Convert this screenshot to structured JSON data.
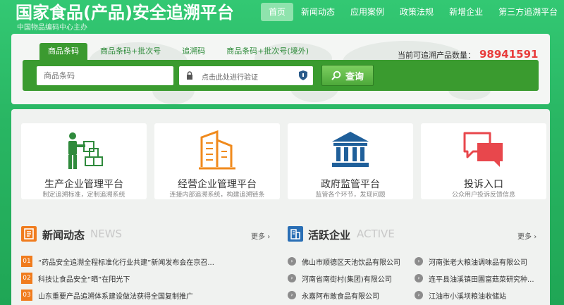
{
  "header": {
    "logo_title": "国家食品(产品)安全追溯平台",
    "logo_subtitle": "中国物品编码中心主办",
    "nav": [
      "首页",
      "新闻动态",
      "应用案例",
      "政策法规",
      "新增企业",
      "第三方追溯平台"
    ]
  },
  "search": {
    "tabs": [
      "商品条码",
      "商品条码+批次号",
      "追溯码",
      "商品条码+批次号(境外)"
    ],
    "count_label": "当前可追溯产品数量：",
    "count_value": "98941591",
    "barcode_placeholder": "商品条码",
    "verify_placeholder": "点击此处进行验证",
    "button_label": "查询"
  },
  "platforms": [
    {
      "title": "生产企业管理平台",
      "subtitle": "制定追溯标准，定制追溯系统",
      "icon": "worker-boxes-icon"
    },
    {
      "title": "经营企业管理平台",
      "subtitle": "连接内部追溯系统，构建追溯链条",
      "icon": "buildings-icon"
    },
    {
      "title": "政府监管平台",
      "subtitle": "监管各个环节，发现问题",
      "icon": "government-icon"
    },
    {
      "title": "投诉入口",
      "subtitle": "公众用户投诉反馈信息",
      "icon": "chat-bubbles-icon"
    }
  ],
  "news": {
    "title": "新闻动态",
    "title_en": "NEWS",
    "more": "更多",
    "items": [
      {
        "num": "01",
        "text": "“药品安全追溯全程标准化行业共建”新闻发布会在京召..."
      },
      {
        "num": "02",
        "text": "科技让食品安全“晒”在阳光下"
      },
      {
        "num": "03",
        "text": "山东重要产品追溯体系建设做法获得全国复制推广"
      }
    ]
  },
  "enterprises": {
    "title": "活跃企业",
    "title_en": "ACTIVE",
    "more": "更多",
    "left": [
      "佛山市顺德区天池饮品有限公司",
      "河南省南街村(集团)有限公司",
      "永嘉阿布敢食品有限公司"
    ],
    "right": [
      "河南张老大粮油调味品有限公司",
      "连平县油溪镇田園富菇菜研究种...",
      "江油市小溪坝粮油收储站"
    ]
  },
  "colors": {
    "brand_green": "#2bbd6a",
    "bar_green": "#3a9b2f",
    "count_red": "#e83c3c",
    "news_orange": "#f07c1e",
    "active_blue": "#2a6fb5"
  }
}
